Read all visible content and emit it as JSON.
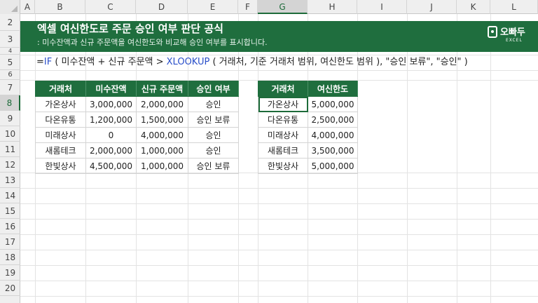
{
  "columns": [
    "A",
    "B",
    "C",
    "D",
    "E",
    "F",
    "G",
    "H",
    "I",
    "J",
    "K",
    "L"
  ],
  "active_column": "G",
  "rows": [
    "2",
    "3",
    "4",
    "5",
    "6",
    "7",
    "8",
    "9",
    "10",
    "11",
    "12",
    "13",
    "14",
    "15",
    "16",
    "17",
    "18",
    "19",
    "20"
  ],
  "active_row": "8",
  "banner": {
    "title": "엑셀 여신한도로 주문 승인 여부 판단 공식",
    "subtitle": ": 미수잔액과 신규 주문액을 여신한도와 비교해 승인 여부를 표시합니다.",
    "logo_text": "오빠두",
    "logo_sub": "EXCEL",
    "bg_color": "#1f6e3e"
  },
  "formula": {
    "eq": "=",
    "fn_if": "IF",
    "part1": " ( 미수잔액 + 신규 주문액 > ",
    "fn_xlookup": "XLOOKUP",
    "part2": " ( 거래처, 기준 거래처 범위, 여신한도 범위 ), \"승인 보류\", \"승인\" )"
  },
  "orders_table": {
    "headers": [
      "거래처",
      "미수잔액",
      "신규 주문액",
      "승인 여부"
    ],
    "rows": [
      [
        "가온상사",
        "3,000,000",
        "2,000,000",
        "승인"
      ],
      [
        "다온유통",
        "1,200,000",
        "1,500,000",
        "승인 보류"
      ],
      [
        "미래상사",
        "0",
        "4,000,000",
        "승인"
      ],
      [
        "새롬테크",
        "2,000,000",
        "1,000,000",
        "승인"
      ],
      [
        "한빛상사",
        "4,500,000",
        "1,000,000",
        "승인 보류"
      ]
    ]
  },
  "limits_table": {
    "headers": [
      "거래처",
      "여신한도"
    ],
    "rows": [
      [
        "가온상사",
        "5,000,000"
      ],
      [
        "다온유통",
        "2,500,000"
      ],
      [
        "미래상사",
        "4,000,000"
      ],
      [
        "새롬테크",
        "3,500,000"
      ],
      [
        "한빛상사",
        "5,000,000"
      ]
    ]
  }
}
